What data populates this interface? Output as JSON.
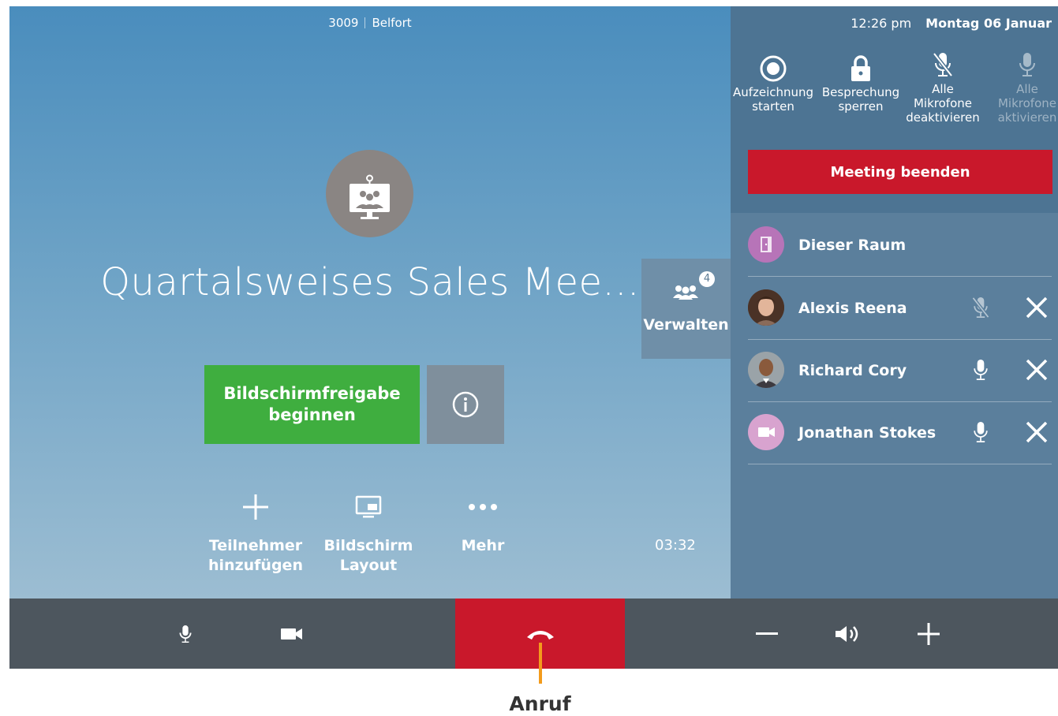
{
  "header": {
    "room_number": "3009",
    "room_name": "Belfort"
  },
  "meeting": {
    "title": "Quartalsweises Sales Mee...",
    "icon": "meeting-room-screen-icon",
    "timer": "03:32"
  },
  "share_button": {
    "line1": "Bildschirmfreigabe",
    "line2": "beginnen"
  },
  "info_button": {
    "icon": "info-icon"
  },
  "actions": {
    "add": {
      "line1": "Teilnehmer",
      "line2": "hinzufügen",
      "icon": "plus-icon"
    },
    "layout": {
      "line1": "Bildschirm",
      "line2": "Layout",
      "icon": "screen-layout-icon"
    },
    "more": {
      "line1": "Mehr",
      "icon": "more-dots-icon"
    }
  },
  "manage": {
    "label": "Verwalten",
    "count": "4",
    "icon": "participants-icon"
  },
  "side": {
    "time": "12:26 pm",
    "date": "Montag 06 Januar",
    "controls": {
      "record": {
        "line1": "Aufzeichnung",
        "line2": "starten",
        "icon": "record-icon"
      },
      "lock": {
        "line1": "Besprechung",
        "line2": "sperren",
        "icon": "lock-icon"
      },
      "mute_all": {
        "line1": "Alle",
        "line2": "Mikrofone",
        "line3": "deaktivieren",
        "icon": "mic-muted-icon"
      },
      "unmute_all": {
        "line1": "Alle",
        "line2": "Mikrofone",
        "line3": "aktivieren",
        "icon": "mic-icon"
      }
    },
    "end_meeting": "Meeting beenden",
    "participants": [
      {
        "name": "Dieser Raum"
      },
      {
        "name": "Alexis Reena"
      },
      {
        "name": "Richard Cory"
      },
      {
        "name": "Jonathan Stokes"
      }
    ]
  },
  "bottom_bar": {
    "icons": [
      "mic-icon",
      "camera-icon",
      "hangup-icon",
      "volume-down-icon",
      "speaker-icon",
      "volume-up-icon"
    ]
  },
  "callout": {
    "label": "Anruf"
  },
  "colors": {
    "accent_red": "#c9182b",
    "share_green": "#3fae3f",
    "callout_orange": "#f39b1c"
  }
}
